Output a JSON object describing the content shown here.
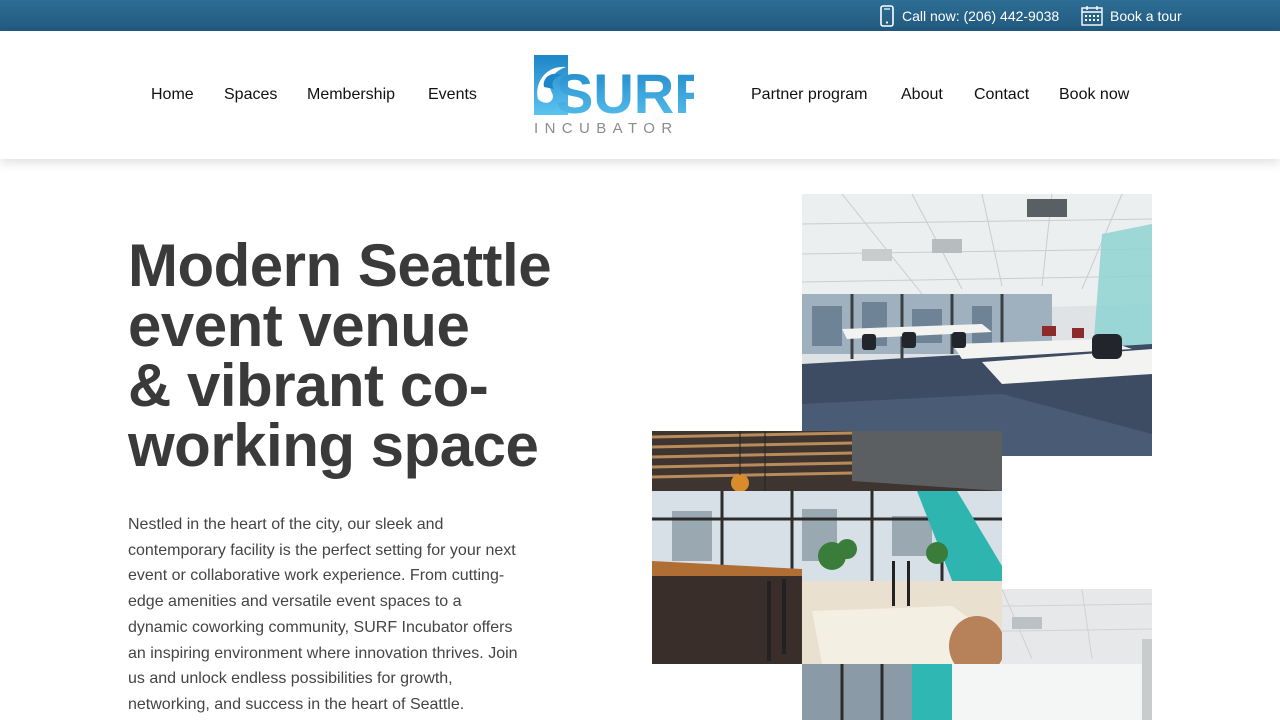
{
  "topbar": {
    "phone_icon": "mobile-phone-icon",
    "call_label": "Call now: (206) 442-9038",
    "calendar_icon": "calendar-icon",
    "tour_label": "Book a tour"
  },
  "nav": {
    "left": [
      "Home",
      "Spaces",
      "Membership",
      "Events"
    ],
    "right": [
      "Partner program",
      "About",
      "Contact",
      "Book now"
    ]
  },
  "logo": {
    "word": "SURF",
    "sub": "INCUBATOR",
    "colors": {
      "blue_dark": "#1c86c8",
      "blue_light": "#5cc3ef",
      "gray": "#8c8c8c"
    }
  },
  "hero": {
    "title_lines": [
      "Modern Seattle",
      "event venue",
      "& vibrant co-",
      "working space"
    ],
    "body": "Nestled in the heart of the city, our sleek and contemporary facility is the perfect setting for your next event or collaborative work experience. From cutting-edge amenities and versatile event spaces to a dynamic coworking community, SURF Incubator offers an inspiring environment where innovation thrives. Join us and unlock endless possibilities for growth, networking, and success in the heart of Seattle."
  },
  "colors": {
    "topbar": "#2a6589",
    "title": "#3a3a3a",
    "body_text": "#444444"
  }
}
